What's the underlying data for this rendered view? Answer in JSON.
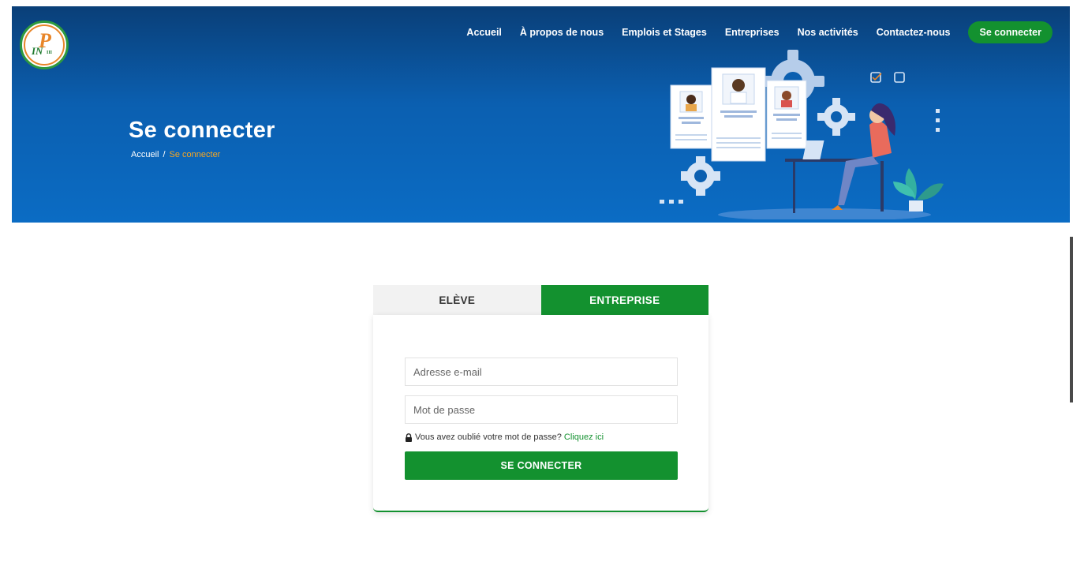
{
  "nav": {
    "items": [
      "Accueil",
      "À propos de nous",
      "Emplois et Stages",
      "Entreprises",
      "Nos activités",
      "Contactez-nous"
    ],
    "login_button": "Se connecter"
  },
  "hero": {
    "title": "Se connecter",
    "breadcrumb": {
      "home": "Accueil",
      "separator": "/",
      "current": "Se connecter"
    }
  },
  "tabs": [
    {
      "label": "ELÈVE",
      "active": false
    },
    {
      "label": "ENTREPRISE",
      "active": true
    }
  ],
  "form": {
    "email_placeholder": "Adresse e-mail",
    "password_placeholder": "Mot de passe",
    "forgot_text": "Vous avez oublié votre mot de passe?",
    "forgot_link": "Cliquez ici",
    "submit_label": "SE CONNECTER"
  },
  "colors": {
    "brand_green": "#13912f",
    "hero_blue": "#0b5fb0",
    "breadcrumb_accent": "#f5a623"
  },
  "icons": [
    "logo-icon",
    "lock-icon",
    "checkbox-checked-icon",
    "checkbox-icon",
    "gear-icon",
    "profile-card-icon",
    "plant-icon"
  ]
}
